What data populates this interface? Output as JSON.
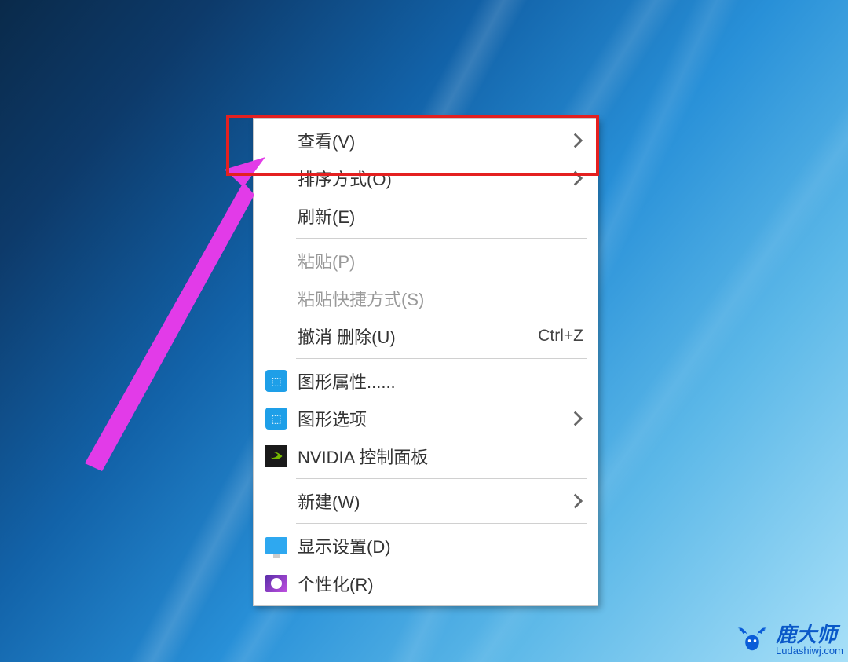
{
  "menu": {
    "items": [
      {
        "label": "查看(V)",
        "has_submenu": true,
        "icon": "none",
        "disabled": false
      },
      {
        "label": "排序方式(O)",
        "has_submenu": true,
        "icon": "none",
        "disabled": false
      },
      {
        "label": "刷新(E)",
        "has_submenu": false,
        "icon": "none",
        "disabled": false
      }
    ],
    "group2": [
      {
        "label": "粘贴(P)",
        "has_submenu": false,
        "icon": "none",
        "disabled": true
      },
      {
        "label": "粘贴快捷方式(S)",
        "has_submenu": false,
        "icon": "none",
        "disabled": true
      },
      {
        "label": "撤消 删除(U)",
        "has_submenu": false,
        "icon": "none",
        "shortcut": "Ctrl+Z",
        "disabled": false
      }
    ],
    "group3": [
      {
        "label": "图形属性......",
        "has_submenu": false,
        "icon": "gfx-blue",
        "disabled": false
      },
      {
        "label": "图形选项",
        "has_submenu": true,
        "icon": "gfx-blue",
        "disabled": false
      },
      {
        "label": "NVIDIA 控制面板",
        "has_submenu": false,
        "icon": "nvidia",
        "disabled": false
      }
    ],
    "group4": [
      {
        "label": "新建(W)",
        "has_submenu": true,
        "icon": "none",
        "disabled": false
      }
    ],
    "group5": [
      {
        "label": "显示设置(D)",
        "has_submenu": false,
        "icon": "display",
        "disabled": false
      },
      {
        "label": "个性化(R)",
        "has_submenu": false,
        "icon": "personalize",
        "disabled": false
      }
    ]
  },
  "watermark": {
    "brand": "鹿大师",
    "url": "Ludashiwj.com"
  },
  "annotation": {
    "arrow_color": "#e23be8",
    "highlight_color": "#e42020"
  }
}
